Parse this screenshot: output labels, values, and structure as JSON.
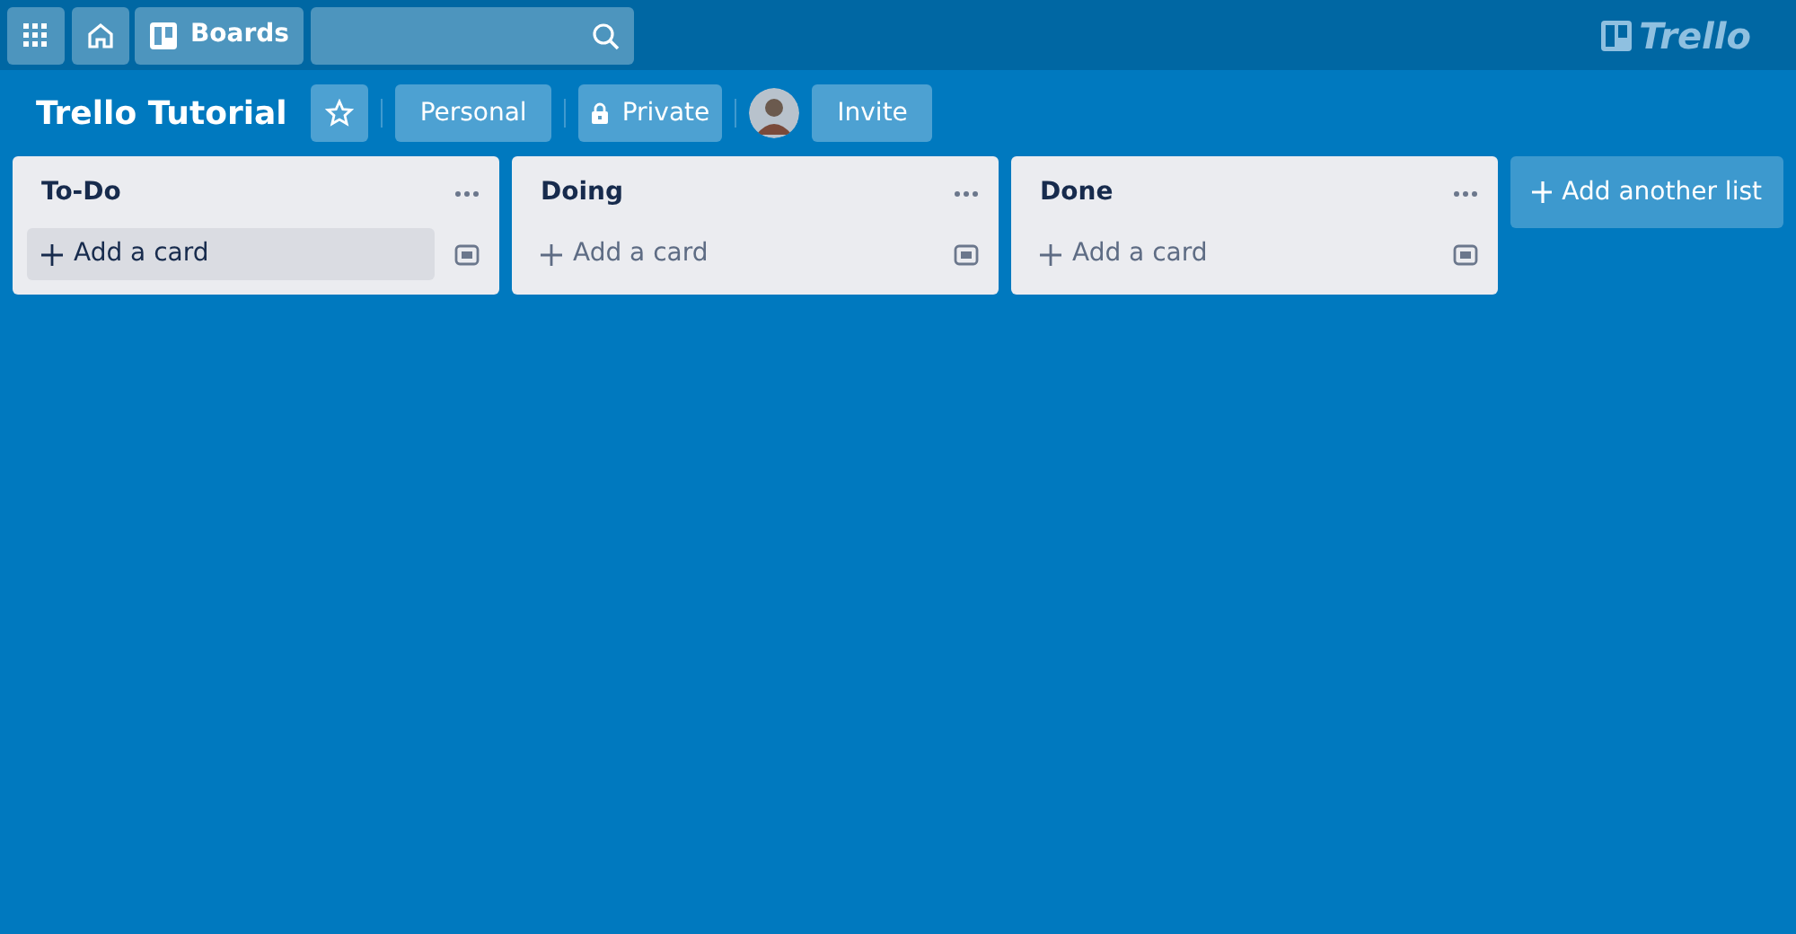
{
  "header": {
    "boards_label": "Boards",
    "logo": "Trello"
  },
  "board": {
    "title": "Trello Tutorial",
    "starred": false,
    "team": "Personal",
    "visibility": "Private",
    "invite": "Invite"
  },
  "lists": [
    {
      "title": "To-Do",
      "add_card": "Add a card",
      "hovered": true
    },
    {
      "title": "Doing",
      "add_card": "Add a card",
      "hovered": false
    },
    {
      "title": "Done",
      "add_card": "Add a card",
      "hovered": false
    }
  ],
  "add_list": "Add another list"
}
